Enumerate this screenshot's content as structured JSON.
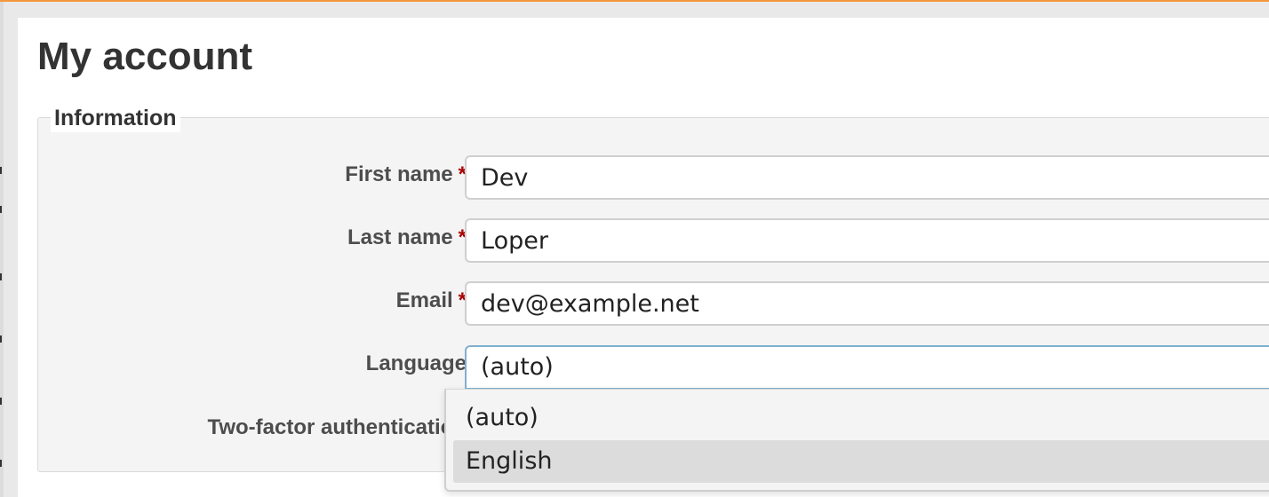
{
  "page": {
    "title": "My account"
  },
  "information": {
    "legend": "Information",
    "required_marker": "*",
    "first_name": {
      "label": "First name",
      "value": "Dev"
    },
    "last_name": {
      "label": "Last name",
      "value": "Loper"
    },
    "email": {
      "label": "Email",
      "value": "dev@example.net"
    },
    "language": {
      "label": "Language",
      "selected": "(auto)",
      "options": [
        "(auto)",
        "English"
      ],
      "highlighted_option": "English"
    },
    "two_factor": {
      "label": "Two-factor authentication"
    }
  },
  "colors": {
    "accent_strip": "#f6963c",
    "required": "#aa0000",
    "focus_border": "#7fb0cf"
  }
}
